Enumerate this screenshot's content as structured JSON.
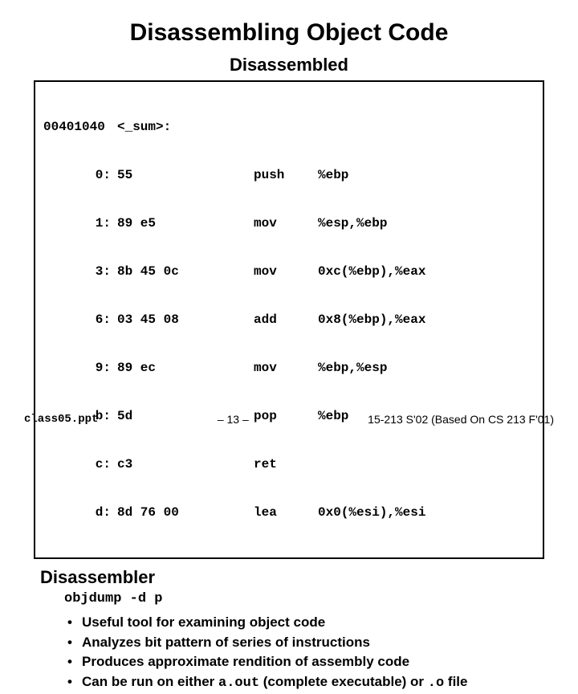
{
  "title": "Disassembling Object Code",
  "subhead": "Disassembled",
  "code": {
    "header_addr": "00401040",
    "header_bytes": "<_sum>:",
    "rows": [
      {
        "addr": "0:",
        "bytes": "55",
        "mnem": "push",
        "ops": "%ebp"
      },
      {
        "addr": "1:",
        "bytes": "89 e5",
        "mnem": "mov",
        "ops": "%esp,%ebp"
      },
      {
        "addr": "3:",
        "bytes": "8b 45 0c",
        "mnem": "mov",
        "ops": "0xc(%ebp),%eax"
      },
      {
        "addr": "6:",
        "bytes": "03 45 08",
        "mnem": "add",
        "ops": "0x8(%ebp),%eax"
      },
      {
        "addr": "9:",
        "bytes": "89 ec",
        "mnem": "mov",
        "ops": "%ebp,%esp"
      },
      {
        "addr": "b:",
        "bytes": "5d",
        "mnem": "pop",
        "ops": "%ebp"
      },
      {
        "addr": "c:",
        "bytes": "c3",
        "mnem": "ret",
        "ops": ""
      },
      {
        "addr": "d:",
        "bytes": "8d 76 00",
        "mnem": "lea",
        "ops": "0x0(%esi),%esi"
      }
    ]
  },
  "section_head": "Disassembler",
  "command": "objdump -d p",
  "bullets": [
    {
      "pre": "Useful tool for examining object code"
    },
    {
      "pre": "Analyzes bit pattern of series of instructions"
    },
    {
      "pre": "Produces approximate rendition of assembly code"
    },
    {
      "pre": "Can be run on either ",
      "mono1": "a.out",
      "mid": " (complete executable) or ",
      "mono2": ".o",
      "post": " file"
    }
  ],
  "footer": {
    "left": "class05.ppt",
    "mid": "– 13 –",
    "right": "15-213 S'02 (Based On CS 213 F'01)"
  }
}
